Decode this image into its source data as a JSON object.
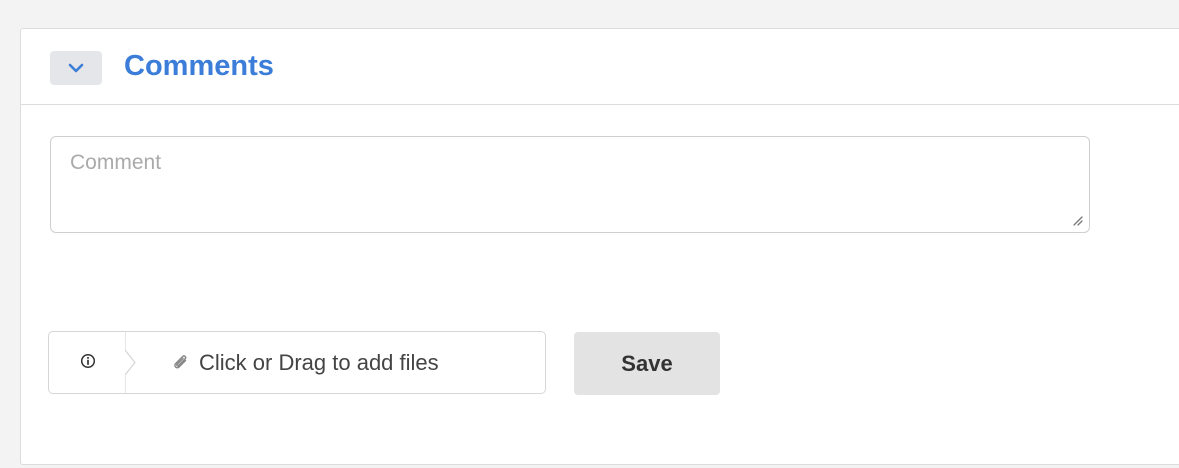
{
  "comments_panel": {
    "title": "Comments",
    "toggle_icon": "chevron-down-icon",
    "title_color": "#3b7dd8"
  },
  "comment_field": {
    "placeholder": "Comment",
    "value": ""
  },
  "attachments": {
    "info_icon": "info-icon",
    "paperclip_icon": "paperclip-icon",
    "dropzone_label": "Click or Drag to add files"
  },
  "actions": {
    "save_label": "Save"
  }
}
